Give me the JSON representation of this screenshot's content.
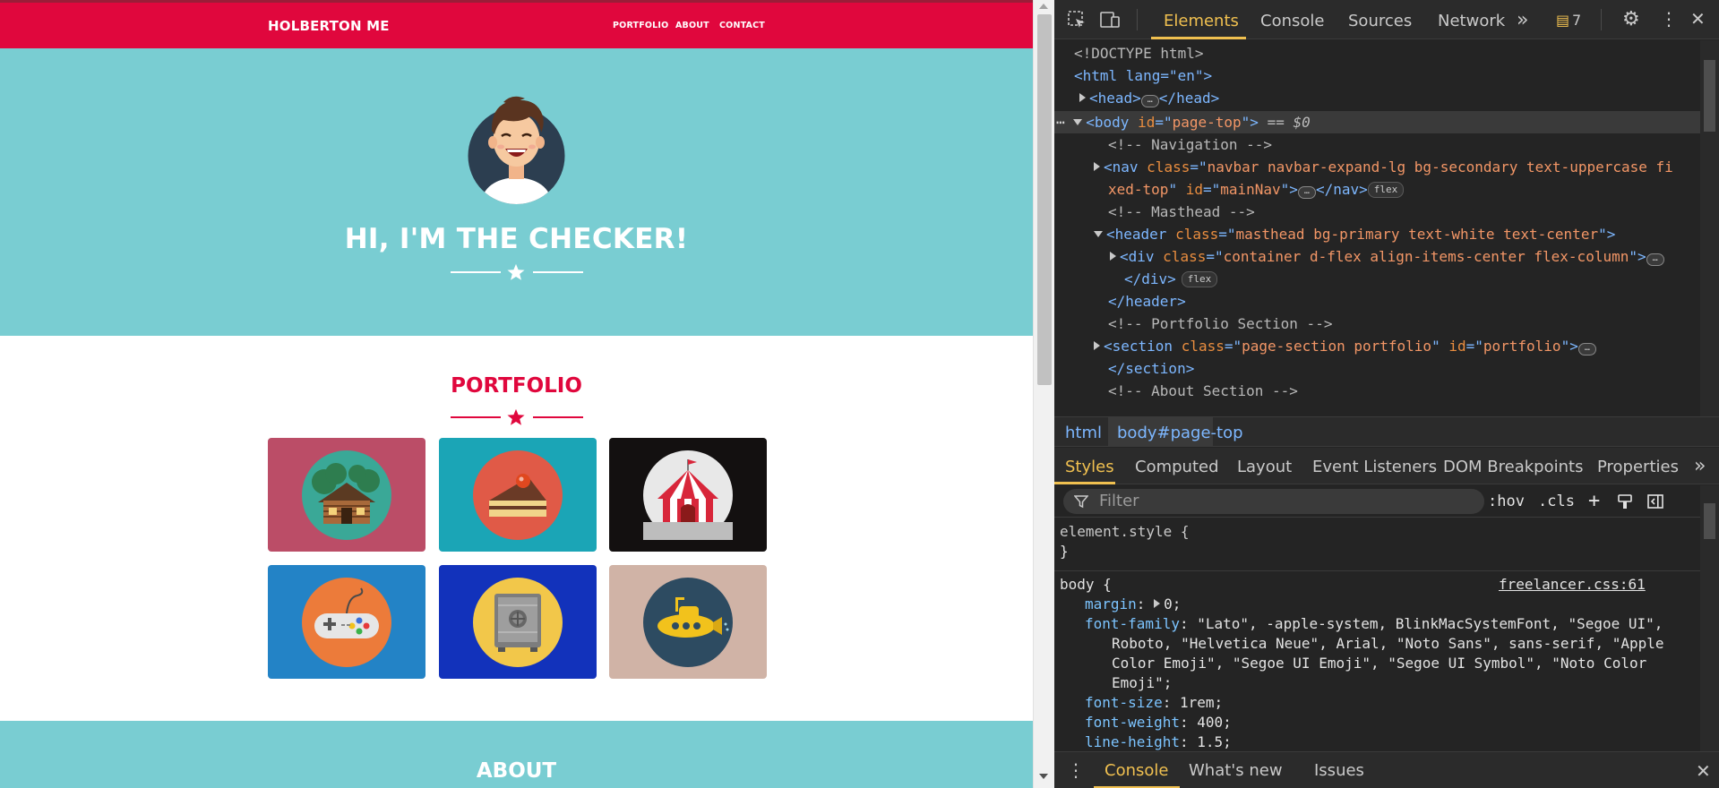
{
  "site": {
    "brand": "HOLBERTON ME",
    "nav": [
      {
        "label": "PORTFOLIO"
      },
      {
        "label": "ABOUT"
      },
      {
        "label": "CONTACT"
      }
    ],
    "hero_title": "HI, I'M THE CHECKER!",
    "portfolio_title": "PORTFOLIO",
    "about_title": "ABOUT",
    "colors": {
      "primary": "#e0073d",
      "secondary": "#79cdd2"
    },
    "portfolio_items": [
      {
        "icon": "cabin-icon",
        "bg": "#bb4d67"
      },
      {
        "icon": "cake-icon",
        "bg": "#1ba5b6"
      },
      {
        "icon": "circus-tent-icon",
        "bg": "#131010"
      },
      {
        "icon": "game-controller-icon",
        "bg": "#2383c6"
      },
      {
        "icon": "safe-icon",
        "bg": "#1232bb"
      },
      {
        "icon": "submarine-icon",
        "bg": "#d0b3a6"
      }
    ]
  },
  "devtools": {
    "tabs": [
      "Elements",
      "Console",
      "Sources",
      "Network"
    ],
    "issues_count": "7",
    "elements_lines": {
      "doctype": "<!DOCTYPE html>",
      "html_open": "<html lang=\"en\">",
      "head": "<head>",
      "head_close": "</head>",
      "body_marker": "== $0",
      "comment_nav": "<!-- Navigation -->",
      "nav_class": "navbar navbar-expand-lg bg-secondary text-uppercase fi",
      "nav_class_cont": "xed-top",
      "nav_id": "mainNav",
      "comment_masthead": "<!-- Masthead -->",
      "header_class": "masthead bg-primary text-white text-center",
      "div_class": "container d-flex align-items-center flex-column",
      "div_close": "</div>",
      "header_close": "</header>",
      "comment_portfolio": "<!-- Portfolio Section -->",
      "section_class": "page-section portfolio",
      "section_id": "portfolio",
      "section_close": "</section>",
      "comment_about": "<!-- About Section -->",
      "flex_badge": "flex"
    },
    "breadcrumbs": [
      "html",
      "body#page-top"
    ],
    "styles_tabs": [
      "Styles",
      "Computed",
      "Layout",
      "Event Listeners",
      "DOM Breakpoints",
      "Properties"
    ],
    "filter_placeholder": "Filter",
    "filter_buttons": [
      ":hov",
      ".cls"
    ],
    "styles": {
      "element_style": "element.style {",
      "close_brace": "}",
      "body_selector": "body {",
      "source": "freelancer.css:61",
      "margin_prop": "margin",
      "margin_val": "0;",
      "ff_prop": "font-family",
      "ff_val_1": "\"Lato\", -apple-system, BlinkMacSystemFont, \"Segoe UI\",",
      "ff_val_2": "Roboto, \"Helvetica Neue\", Arial, \"Noto Sans\", sans-serif, \"Apple",
      "ff_val_3": "Color Emoji\", \"Segoe UI Emoji\", \"Segoe UI Symbol\", \"Noto Color",
      "ff_val_4": "Emoji\";",
      "fs_prop": "font-size",
      "fs_val": "1rem;",
      "fw_prop": "font-weight",
      "fw_val": "400;",
      "lh_prop": "line-height",
      "lh_val": "1.5;"
    },
    "drawer_tabs": [
      "Console",
      "What's new",
      "Issues"
    ]
  }
}
